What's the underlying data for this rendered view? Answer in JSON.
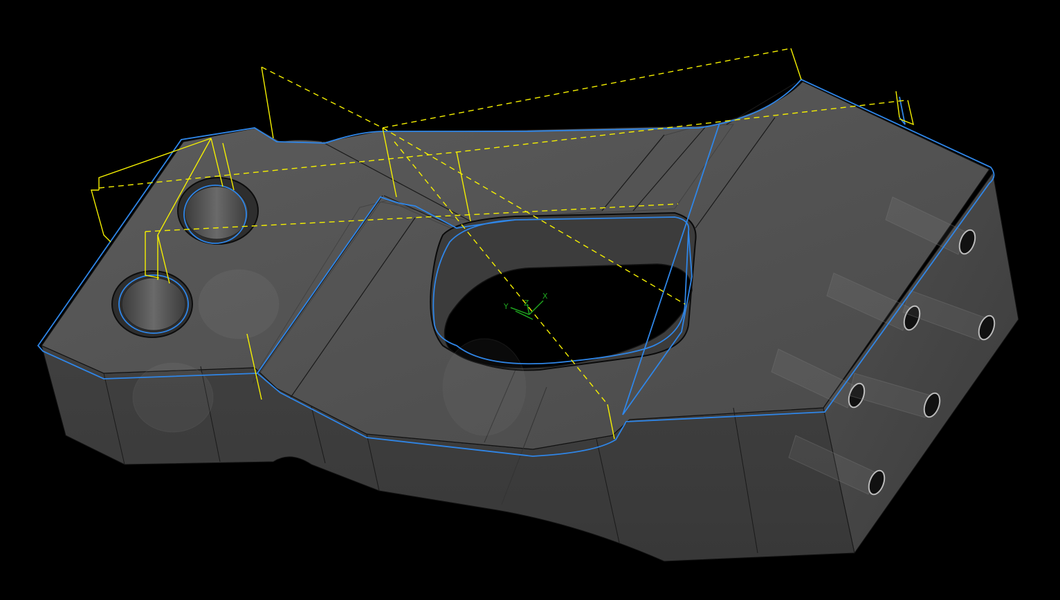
{
  "viewport": {
    "background": "#000000",
    "part_color": "#4a4a4a",
    "boundary_color": "#2f86e8",
    "toolpath_color": "#f5f000",
    "triad_color": "#1fa51f"
  },
  "triad": {
    "x_label": "X",
    "y_label": "Y",
    "z_label": "Z"
  }
}
